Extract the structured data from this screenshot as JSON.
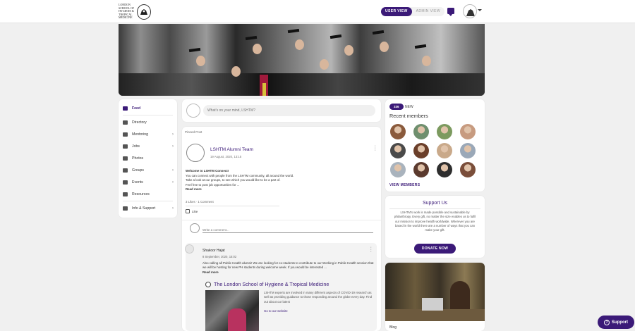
{
  "header": {
    "logo_text": "London School of Hygiene & Tropical Medicine",
    "view_toggle": {
      "user": "USER VIEW",
      "admin": "ADMIN VIEW"
    }
  },
  "sidebar": {
    "items": [
      {
        "label": "Feed",
        "icon": "feed-icon",
        "active": true
      },
      {
        "label": "Directory",
        "icon": "directory-icon"
      },
      {
        "label": "Mentoring",
        "icon": "mentoring-icon",
        "chevron": "›"
      },
      {
        "label": "Jobs",
        "icon": "briefcase-icon",
        "chevron": "›"
      },
      {
        "label": "Photos",
        "icon": "photo-icon"
      },
      {
        "label": "Groups",
        "icon": "groups-icon",
        "chevron": "›"
      },
      {
        "label": "Events",
        "icon": "calendar-icon",
        "chevron": "›"
      },
      {
        "label": "Resources",
        "icon": "resources-icon"
      },
      {
        "label": "Info & Support",
        "icon": "info-icon",
        "chevron": "›"
      }
    ]
  },
  "composer": {
    "placeholder": "What's on your mind, LSHTM?"
  },
  "post": {
    "pinned_label": "Pinned Post",
    "author": "LSHTM Alumni Team",
    "date": "19 August, 2020, 13:15",
    "heading": "Welcome to LSHTM Connect!",
    "lines": [
      "You can connect with people from the LSHTM community, all around the world.",
      "Take a look at our groups, to see which you would like to be a part of.",
      "Feel free to post job opportunities for ..."
    ],
    "read_more": "Read more",
    "stats": "3 Likes  ·  1 Comment",
    "like_label": "Like",
    "comment_placeholder": "Write a comment..."
  },
  "comment": {
    "author": "Shakoor Hajat",
    "date": "8 September, 2020, 15:02",
    "text": "Also calling all Public Health alumni! We are looking for ex-students to contribute to our Working in Public Health session that we will be hosting for new PH students during welcome week. If you would be interested ...",
    "read_more": "Read more",
    "link_title": "The London School of Hygiene & Tropical Medicine",
    "link_desc": "LSHTM experts are involved in many different aspects of COVID-19 research as well as providing guidance to those responding around the globe every day. Find out about our latest",
    "link_go": "Go to our website"
  },
  "members": {
    "count": "336",
    "new_label": "NEW",
    "title": "Recent members",
    "avatar_colors": [
      "#8a5a3c",
      "#6f8f6e",
      "#7c9a5f",
      "#c79b80",
      "#4a4a4a",
      "#6b3f2a",
      "#c9a98a",
      "#9aa8b8",
      "#a9b3bd",
      "#5b3a2e",
      "#2e2e2e",
      "#7a4e3a"
    ],
    "view_label": "VIEW MEMBERS"
  },
  "support": {
    "title": "Support Us",
    "text": "LSHTM's work is made possible and sustainable by philanthropy. Every gift, no matter the size enables us to fulfil our mission to improve health worldwide. Wherever you are based in the world there are a number of ways that you can make your gift.",
    "donate_label": "DONATE NOW"
  },
  "blog": {
    "title": "Blog"
  },
  "fab": {
    "label": "Support",
    "icon": "?"
  },
  "colors": {
    "brand": "#3b1a78",
    "background": "#f0f0f0"
  }
}
